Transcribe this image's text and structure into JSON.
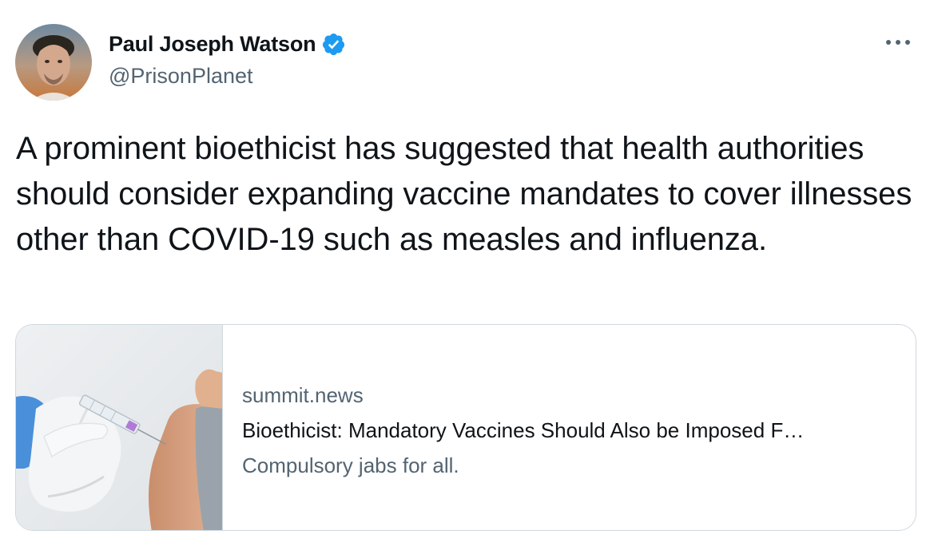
{
  "author": {
    "display_name": "Paul Joseph Watson",
    "handle": "@PrisonPlanet",
    "verified": true
  },
  "tweet": {
    "text": "A prominent bioethicist has suggested that health authorities should consider expanding vaccine mandates to cover illnesses other than COVID-19 such as measles and influenza."
  },
  "card": {
    "domain": "summit.news",
    "title": "Bioethicist: Mandatory Vaccines Should Also be Imposed F…",
    "description": "Compulsory jabs for all.",
    "image_subject": "gloved-hand-syringe-arm-injection"
  },
  "icons": {
    "verified": "verified-badge-icon",
    "more": "more-options-icon"
  },
  "colors": {
    "text_primary": "#0f1419",
    "text_secondary": "#536471",
    "verified_blue": "#1d9bf0",
    "border": "#cfd9de"
  }
}
